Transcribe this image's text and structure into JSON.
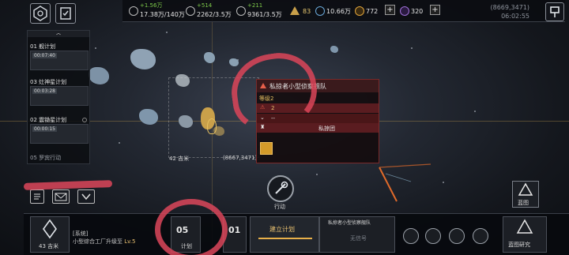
{
  "resources": {
    "metal": {
      "add": "+1.56万",
      "value": "17.38万/140万"
    },
    "crystal": {
      "add": "+514",
      "value": "2262/3.5万"
    },
    "deuterium": {
      "add": "+211",
      "value": "9361/3.5万"
    },
    "level_badge": "83",
    "credits": "10.66万",
    "gems": "772",
    "tokens": "320"
  },
  "coords_top": "(8669,3471)",
  "clock": "06:02:55",
  "plans": {
    "items": [
      {
        "title": "01 舰计划",
        "timer": "00:07:40"
      },
      {
        "title": "03 灶神星计划",
        "timer": "00:03:28"
      },
      {
        "title": "02 震锄星计划",
        "timer": "00:00:15"
      },
      {
        "title": "05 罗宾行动",
        "timer": ""
      }
    ]
  },
  "map": {
    "distance_label": "42 吉米",
    "coord_label": "(8667,3471)"
  },
  "popup": {
    "title": "私掠者小型侦察舰队",
    "level": "等级2",
    "row_count": "2",
    "row_dash": "--",
    "row_faction": "私掠团"
  },
  "action": {
    "label": "行动"
  },
  "bottom": {
    "distance": "43 吉米",
    "sys_tag": "[系统]",
    "sys_msg": "小型综合工厂升级至",
    "sys_level": "Lv.5",
    "plan_count": "05",
    "plan_label": "计划",
    "next_count": "01",
    "build_plan": "建立计划",
    "target_name": "私掠者小型侦察舰队",
    "no_signal": "无信号",
    "blueprint": "蓝图",
    "blueprint_research": "蓝图研究"
  }
}
